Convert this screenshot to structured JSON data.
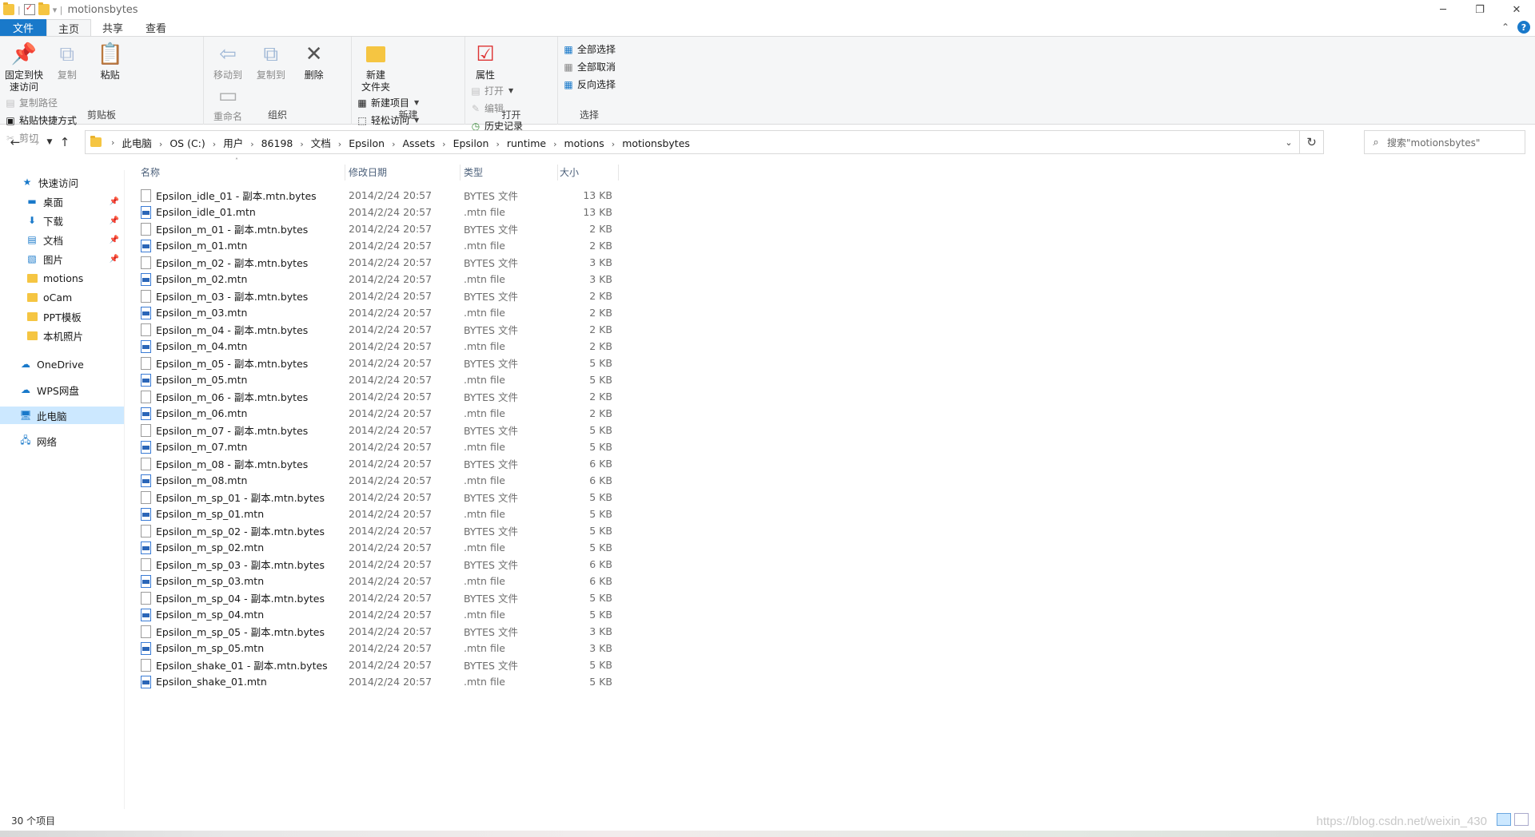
{
  "window": {
    "title": "motionsbytes"
  },
  "ribbon_tabs": [
    "文件",
    "主页",
    "共享",
    "查看"
  ],
  "ribbon": {
    "clipboard": {
      "pin": "固定到快\n速访问",
      "copy": "复制",
      "paste": "粘贴",
      "copy_path": "复制路径",
      "paste_shortcut": "粘贴快捷方式",
      "cut": "剪切",
      "label": "剪贴板"
    },
    "organize": {
      "move_to": "移动到",
      "copy_to": "复制到",
      "delete": "删除",
      "rename": "重命名",
      "label": "组织"
    },
    "new": {
      "new_folder": "新建\n文件夹",
      "new_item": "新建项目",
      "easy_access": "轻松访问",
      "label": "新建"
    },
    "open": {
      "properties": "属性",
      "open": "打开",
      "edit": "编辑",
      "history": "历史记录",
      "label": "打开"
    },
    "select": {
      "select_all": "全部选择",
      "select_none": "全部取消",
      "invert": "反向选择",
      "label": "选择"
    }
  },
  "breadcrumb": [
    "此电脑",
    "OS (C:)",
    "用户",
    "86198",
    "文档",
    "Epsilon",
    "Assets",
    "Epsilon",
    "runtime",
    "motions",
    "motionsbytes"
  ],
  "search": {
    "placeholder": "搜索\"motionsbytes\""
  },
  "nav": {
    "quick_access": "快速访问",
    "items": [
      {
        "label": "桌面",
        "icon": "desktop-icon",
        "pinned": true
      },
      {
        "label": "下载",
        "icon": "download-icon",
        "pinned": true
      },
      {
        "label": "文档",
        "icon": "document-icon",
        "pinned": true
      },
      {
        "label": "图片",
        "icon": "picture-icon",
        "pinned": true
      },
      {
        "label": "motions",
        "icon": "folder-icon",
        "pinned": false
      },
      {
        "label": "oCam",
        "icon": "folder-icon",
        "pinned": false
      },
      {
        "label": "PPT模板",
        "icon": "folder-icon",
        "pinned": false
      },
      {
        "label": "本机照片",
        "icon": "folder-icon",
        "pinned": false
      }
    ],
    "onedrive": "OneDrive",
    "wps": "WPS网盘",
    "this_pc": "此电脑",
    "network": "网络"
  },
  "columns": {
    "name": "名称",
    "date": "修改日期",
    "type": "类型",
    "size": "大小"
  },
  "files": [
    {
      "name": "Epsilon_idle_01 - 副本.mtn.bytes",
      "date": "2014/2/24 20:57",
      "type": "BYTES 文件",
      "size": "13 KB",
      "kind": "bytes"
    },
    {
      "name": "Epsilon_idle_01.mtn",
      "date": "2014/2/24 20:57",
      "type": ".mtn file",
      "size": "13 KB",
      "kind": "mtn"
    },
    {
      "name": "Epsilon_m_01 - 副本.mtn.bytes",
      "date": "2014/2/24 20:57",
      "type": "BYTES 文件",
      "size": "2 KB",
      "kind": "bytes"
    },
    {
      "name": "Epsilon_m_01.mtn",
      "date": "2014/2/24 20:57",
      "type": ".mtn file",
      "size": "2 KB",
      "kind": "mtn"
    },
    {
      "name": "Epsilon_m_02 - 副本.mtn.bytes",
      "date": "2014/2/24 20:57",
      "type": "BYTES 文件",
      "size": "3 KB",
      "kind": "bytes"
    },
    {
      "name": "Epsilon_m_02.mtn",
      "date": "2014/2/24 20:57",
      "type": ".mtn file",
      "size": "3 KB",
      "kind": "mtn"
    },
    {
      "name": "Epsilon_m_03 - 副本.mtn.bytes",
      "date": "2014/2/24 20:57",
      "type": "BYTES 文件",
      "size": "2 KB",
      "kind": "bytes"
    },
    {
      "name": "Epsilon_m_03.mtn",
      "date": "2014/2/24 20:57",
      "type": ".mtn file",
      "size": "2 KB",
      "kind": "mtn"
    },
    {
      "name": "Epsilon_m_04 - 副本.mtn.bytes",
      "date": "2014/2/24 20:57",
      "type": "BYTES 文件",
      "size": "2 KB",
      "kind": "bytes"
    },
    {
      "name": "Epsilon_m_04.mtn",
      "date": "2014/2/24 20:57",
      "type": ".mtn file",
      "size": "2 KB",
      "kind": "mtn"
    },
    {
      "name": "Epsilon_m_05 - 副本.mtn.bytes",
      "date": "2014/2/24 20:57",
      "type": "BYTES 文件",
      "size": "5 KB",
      "kind": "bytes"
    },
    {
      "name": "Epsilon_m_05.mtn",
      "date": "2014/2/24 20:57",
      "type": ".mtn file",
      "size": "5 KB",
      "kind": "mtn"
    },
    {
      "name": "Epsilon_m_06 - 副本.mtn.bytes",
      "date": "2014/2/24 20:57",
      "type": "BYTES 文件",
      "size": "2 KB",
      "kind": "bytes"
    },
    {
      "name": "Epsilon_m_06.mtn",
      "date": "2014/2/24 20:57",
      "type": ".mtn file",
      "size": "2 KB",
      "kind": "mtn"
    },
    {
      "name": "Epsilon_m_07 - 副本.mtn.bytes",
      "date": "2014/2/24 20:57",
      "type": "BYTES 文件",
      "size": "5 KB",
      "kind": "bytes"
    },
    {
      "name": "Epsilon_m_07.mtn",
      "date": "2014/2/24 20:57",
      "type": ".mtn file",
      "size": "5 KB",
      "kind": "mtn"
    },
    {
      "name": "Epsilon_m_08 - 副本.mtn.bytes",
      "date": "2014/2/24 20:57",
      "type": "BYTES 文件",
      "size": "6 KB",
      "kind": "bytes"
    },
    {
      "name": "Epsilon_m_08.mtn",
      "date": "2014/2/24 20:57",
      "type": ".mtn file",
      "size": "6 KB",
      "kind": "mtn"
    },
    {
      "name": "Epsilon_m_sp_01 - 副本.mtn.bytes",
      "date": "2014/2/24 20:57",
      "type": "BYTES 文件",
      "size": "5 KB",
      "kind": "bytes"
    },
    {
      "name": "Epsilon_m_sp_01.mtn",
      "date": "2014/2/24 20:57",
      "type": ".mtn file",
      "size": "5 KB",
      "kind": "mtn"
    },
    {
      "name": "Epsilon_m_sp_02 - 副本.mtn.bytes",
      "date": "2014/2/24 20:57",
      "type": "BYTES 文件",
      "size": "5 KB",
      "kind": "bytes"
    },
    {
      "name": "Epsilon_m_sp_02.mtn",
      "date": "2014/2/24 20:57",
      "type": ".mtn file",
      "size": "5 KB",
      "kind": "mtn"
    },
    {
      "name": "Epsilon_m_sp_03 - 副本.mtn.bytes",
      "date": "2014/2/24 20:57",
      "type": "BYTES 文件",
      "size": "6 KB",
      "kind": "bytes"
    },
    {
      "name": "Epsilon_m_sp_03.mtn",
      "date": "2014/2/24 20:57",
      "type": ".mtn file",
      "size": "6 KB",
      "kind": "mtn"
    },
    {
      "name": "Epsilon_m_sp_04 - 副本.mtn.bytes",
      "date": "2014/2/24 20:57",
      "type": "BYTES 文件",
      "size": "5 KB",
      "kind": "bytes"
    },
    {
      "name": "Epsilon_m_sp_04.mtn",
      "date": "2014/2/24 20:57",
      "type": ".mtn file",
      "size": "5 KB",
      "kind": "mtn"
    },
    {
      "name": "Epsilon_m_sp_05 - 副本.mtn.bytes",
      "date": "2014/2/24 20:57",
      "type": "BYTES 文件",
      "size": "3 KB",
      "kind": "bytes"
    },
    {
      "name": "Epsilon_m_sp_05.mtn",
      "date": "2014/2/24 20:57",
      "type": ".mtn file",
      "size": "3 KB",
      "kind": "mtn"
    },
    {
      "name": "Epsilon_shake_01 - 副本.mtn.bytes",
      "date": "2014/2/24 20:57",
      "type": "BYTES 文件",
      "size": "5 KB",
      "kind": "bytes"
    },
    {
      "name": "Epsilon_shake_01.mtn",
      "date": "2014/2/24 20:57",
      "type": ".mtn file",
      "size": "5 KB",
      "kind": "mtn"
    }
  ],
  "status": {
    "count": "30 个项目"
  },
  "watermark": "https://blog.csdn.net/weixin_430",
  "colors": {
    "file_tab": "#1979ca",
    "selected": "#cce8ff",
    "folder": "#f5c542"
  }
}
